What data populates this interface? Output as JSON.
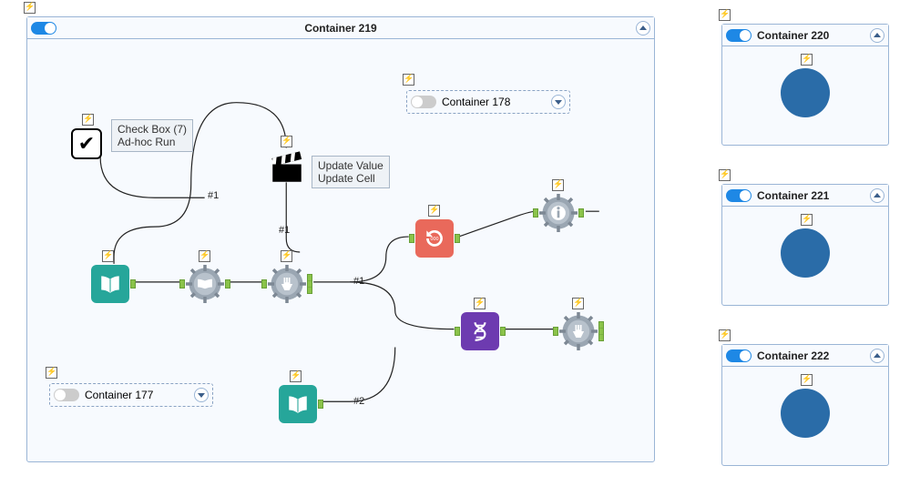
{
  "main_container": {
    "title": "Container 219",
    "enabled": true,
    "sub_containers": {
      "c177": {
        "title": "Container 177",
        "enabled": false
      },
      "c178": {
        "title": "Container 178",
        "enabled": false
      }
    },
    "checkbox": {
      "label_line1": "Check Box (7)",
      "label_line2": "Ad-hoc Run",
      "checked": true
    },
    "comment": {
      "line1": "Update Value",
      "line2": "Update Cell"
    },
    "edge_labels": {
      "e1": "#1",
      "e2": "#1",
      "e3": "#1",
      "e4": "#2"
    }
  },
  "side_containers": [
    {
      "title": "Container 220",
      "enabled": true
    },
    {
      "title": "Container 221",
      "enabled": true
    },
    {
      "title": "Container 222",
      "enabled": true
    }
  ]
}
